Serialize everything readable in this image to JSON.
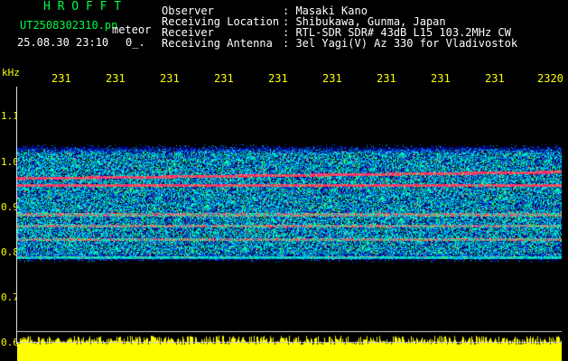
{
  "title_brand": "H R O F F T",
  "file": {
    "name": "UT2508302310.pn",
    "mode": "meteor",
    "datetime": "25.08.30 23:10",
    "extra": "0_."
  },
  "info": [
    {
      "label": "Observer",
      "value": ": Masaki Kano"
    },
    {
      "label": "Receiving Location",
      "value": ": Shibukawa, Gunma, Japan"
    },
    {
      "label": "Receiver",
      "value": ": RTL-SDR SDR# 43dB L15 103.2MHz CW"
    },
    {
      "label": "Receiving Antenna",
      "value": ": 3el Yagi(V) Az 330 for Vladivostok"
    }
  ],
  "chart_data": {
    "type": "heatmap",
    "ylabel": "kHz",
    "yticks": [
      "1.1",
      "1.0",
      "0.9",
      "0.8",
      "0.7",
      "0.6"
    ],
    "xticks": [
      "231",
      "231",
      "231",
      "231",
      "231",
      "231",
      "231",
      "231",
      "231",
      "2320"
    ],
    "ylim": [
      0.6,
      1.15
    ],
    "signal_band_khz": [
      0.78,
      1.04
    ],
    "bright_lines_khz": [
      0.965,
      0.95,
      0.885,
      0.86,
      0.83,
      0.79
    ],
    "colors": {
      "background": "#000000",
      "low": "#0000aa",
      "mid": "#00ffff",
      "high": "#ff3366",
      "level": "#ffff00"
    }
  }
}
